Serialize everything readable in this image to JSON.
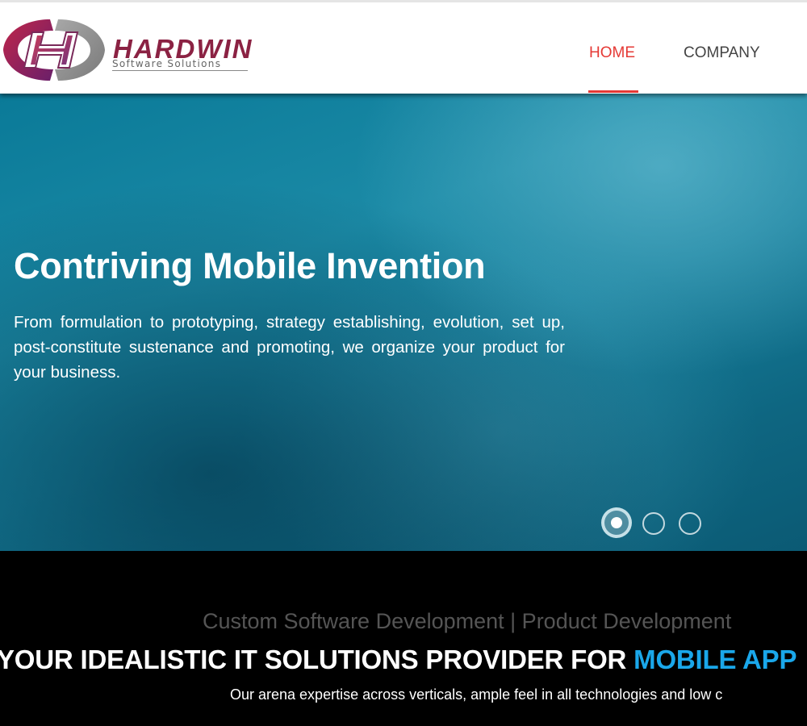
{
  "header": {
    "logo": {
      "brand": "HARDWIN",
      "tagline": "Software Solutions",
      "icon": "hardwin-h-logo-icon"
    },
    "nav": [
      {
        "label": "HOME",
        "active": true
      },
      {
        "label": "COMPANY",
        "active": false
      }
    ]
  },
  "hero": {
    "title": "Contriving Mobile Invention",
    "text": "From formulation to prototyping, strategy establishing, evolution, set up, post-constitute sustenance and promoting, we organize your product for your business.",
    "slides": {
      "count": 3,
      "active_index": 0
    }
  },
  "band": {
    "services": "Custom Software Development | Product Development",
    "headline_prefix": "YOUR IDEALISTIC IT SOLUTIONS PROVIDER FOR ",
    "headline_accent": "MOBILE APP",
    "subline": "Our arena expertise across verticals, ample feel in all technologies and low c"
  },
  "colors": {
    "nav_active": "#e53935",
    "accent": "#1aa7ea",
    "logo_red": "#8b2243",
    "hero_teal": "#1b8aa6"
  }
}
